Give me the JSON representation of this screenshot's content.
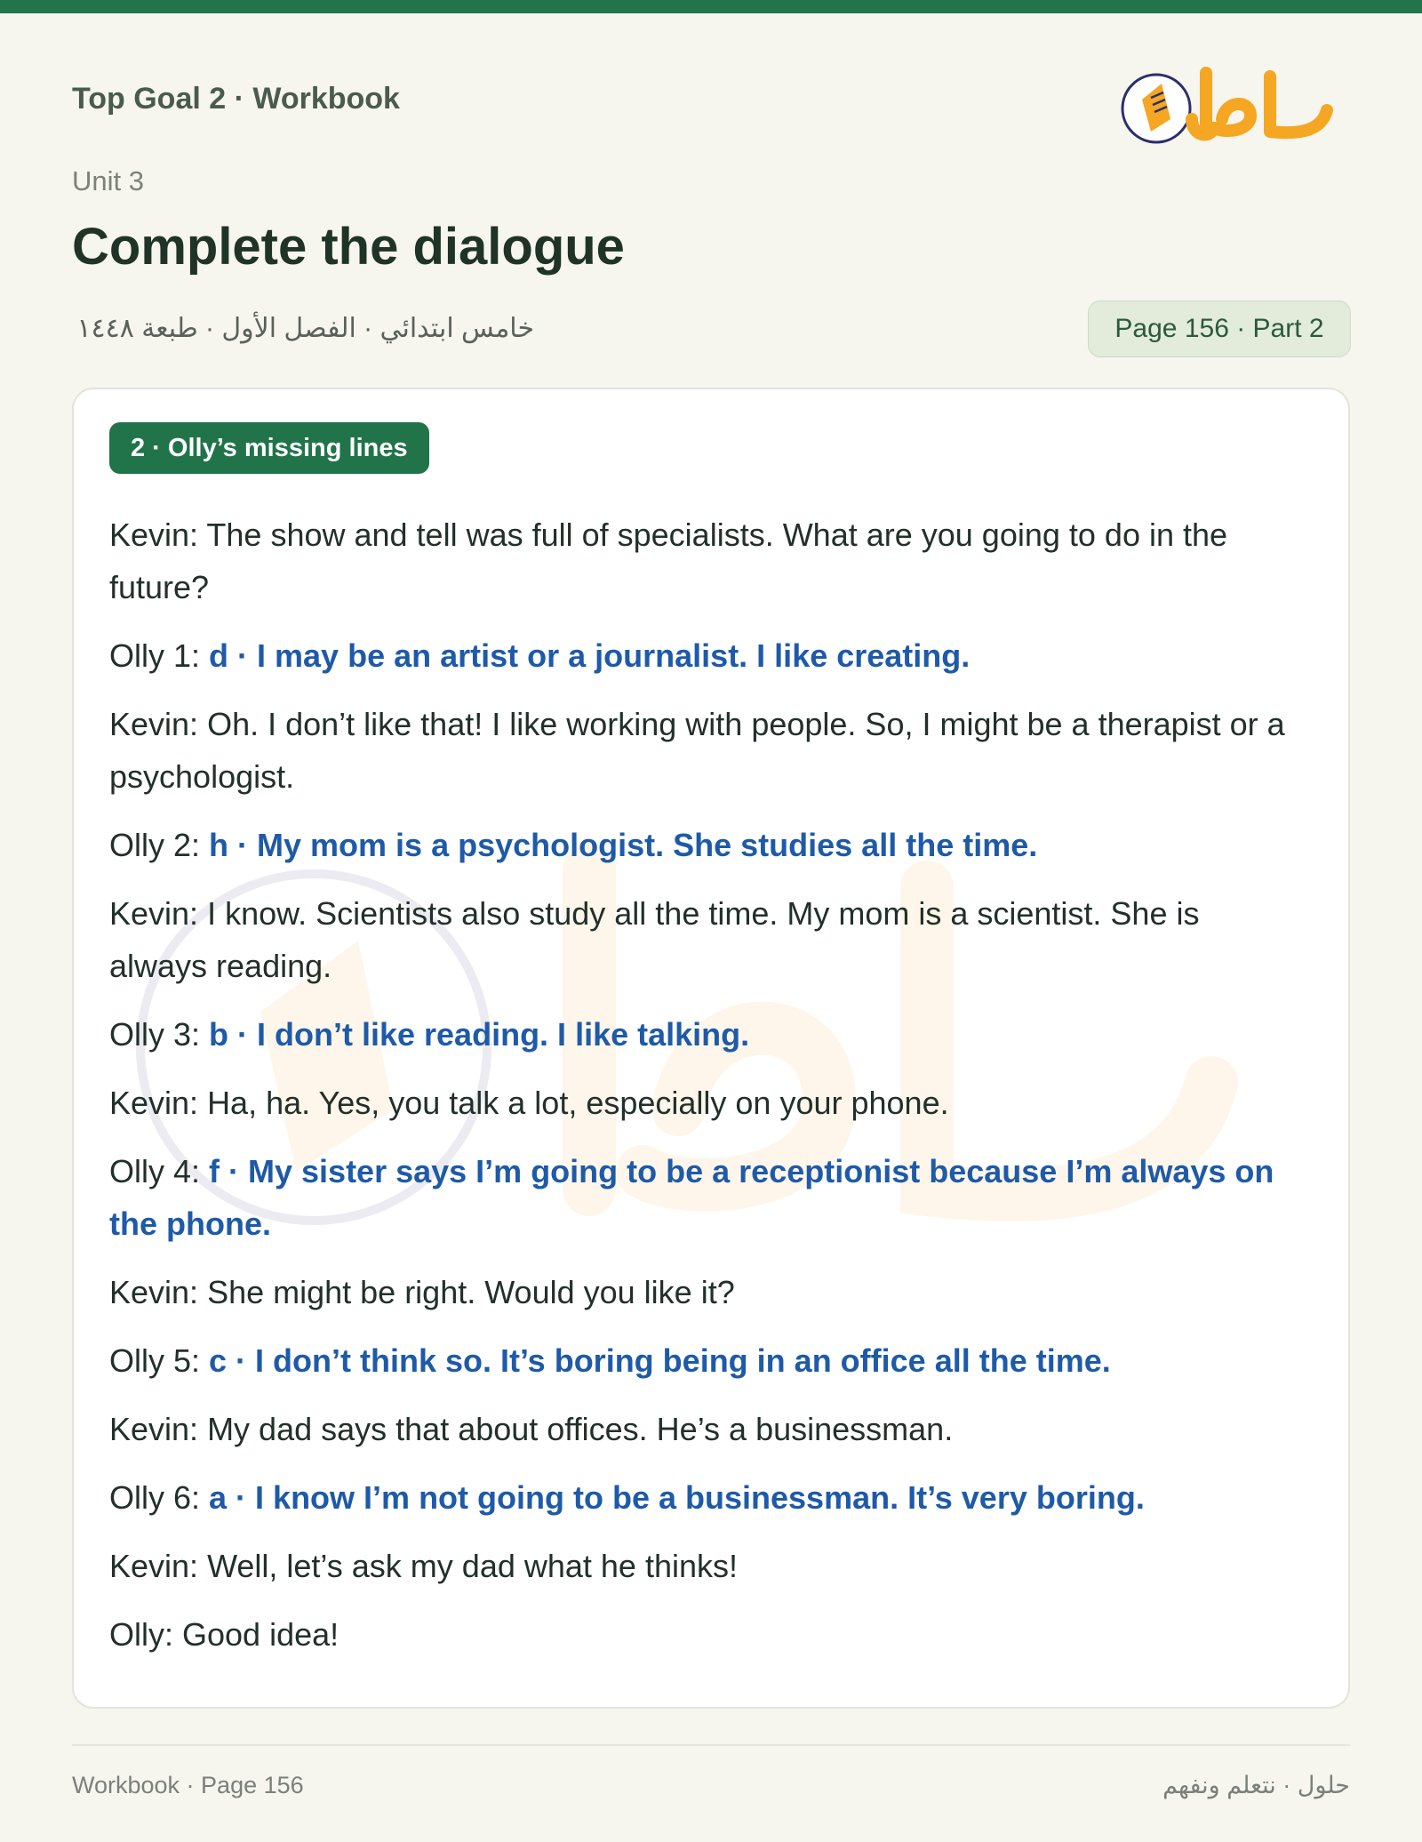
{
  "header": {
    "book_title": "Top Goal 2 · Workbook",
    "unit": "Unit 3",
    "title": "Complete the dialogue",
    "subtitle": "خامس ابتدائي · الفصل الأول · طبعة ١٤٤٨",
    "page_info": "Page 156 · Part 2",
    "logo_text": "حلول"
  },
  "colors": {
    "accent": "#22744a",
    "answer": "#1e5aa8",
    "logo_orange": "#f5a623",
    "logo_navy": "#2b2e6b"
  },
  "section": {
    "badge": "2 · Olly’s missing lines"
  },
  "dialogue": [
    {
      "speaker": "Kevin: ",
      "text": "The show and tell was full of specialists. What are you going to do in the future?",
      "answer": ""
    },
    {
      "speaker": "Olly 1: ",
      "text": "",
      "answer": "d · I may be an artist or a journalist. I like creating."
    },
    {
      "speaker": "Kevin: ",
      "text": "Oh. I don’t like that! I like working with people. So, I might be a therapist or a psychologist.",
      "answer": ""
    },
    {
      "speaker": "Olly 2: ",
      "text": "",
      "answer": "h · My mom is a psychologist. She studies all the time."
    },
    {
      "speaker": "Kevin: ",
      "text": "I know. Scientists also study all the time. My mom is a scientist. She is always reading.",
      "answer": ""
    },
    {
      "speaker": "Olly 3: ",
      "text": "",
      "answer": "b · I don’t like reading. I like talking."
    },
    {
      "speaker": "Kevin: ",
      "text": "Ha, ha. Yes, you talk a lot, especially on your phone.",
      "answer": ""
    },
    {
      "speaker": "Olly 4: ",
      "text": "",
      "answer": "f · My sister says I’m going to be a receptionist because I’m always on the phone."
    },
    {
      "speaker": "Kevin: ",
      "text": "She might be right. Would you like it?",
      "answer": ""
    },
    {
      "speaker": "Olly 5: ",
      "text": "",
      "answer": "c · I don’t think so. It’s boring being in an office all the time."
    },
    {
      "speaker": "Kevin: ",
      "text": "My dad says that about offices. He’s a businessman.",
      "answer": ""
    },
    {
      "speaker": "Olly 6: ",
      "text": "",
      "answer": "a · I know I’m not going to be a businessman. It’s very boring."
    },
    {
      "speaker": "Kevin: ",
      "text": "Well, let’s ask my dad what he thinks!",
      "answer": ""
    },
    {
      "speaker": "Olly: ",
      "text": "Good idea!",
      "answer": ""
    }
  ],
  "footer": {
    "left": "Workbook · Page 156",
    "right": "حلول · نتعلم ونفهم"
  }
}
